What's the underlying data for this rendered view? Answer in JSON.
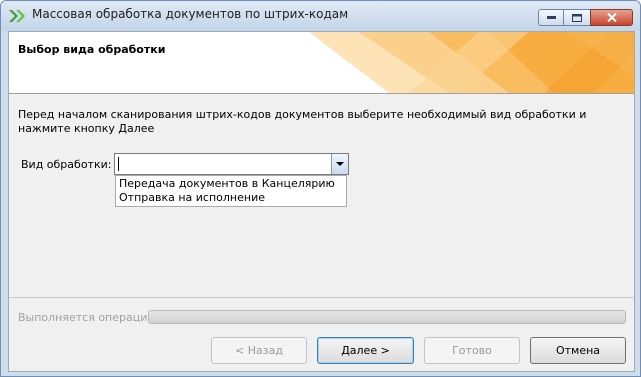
{
  "window": {
    "title": "Массовая обработка документов по штрих-кодам"
  },
  "header": {
    "title": "Выбор вида обработки"
  },
  "instruction": "Перед началом сканирования штрих-кодов документов выберите необходимый вид обработки и нажмите кнопку Далее",
  "processing_type": {
    "label": "Вид обработки:",
    "value": "",
    "options": [
      "Передача документов в Канцелярию",
      "Отправка на исполнение"
    ]
  },
  "progress": {
    "label": "Выполняется операция",
    "value": 0
  },
  "buttons": {
    "back": "< Назад",
    "next": "Далее >",
    "finish": "Готово",
    "cancel": "Отмена"
  },
  "colors": {
    "accent_orange": "#f7a530",
    "progress_fill": "#3aa63a"
  },
  "icons": {
    "app": "double-chevron-right-icon",
    "minimize": "minimize-icon",
    "maximize": "maximize-icon",
    "close": "close-icon",
    "dropdown": "chevron-down-icon"
  }
}
